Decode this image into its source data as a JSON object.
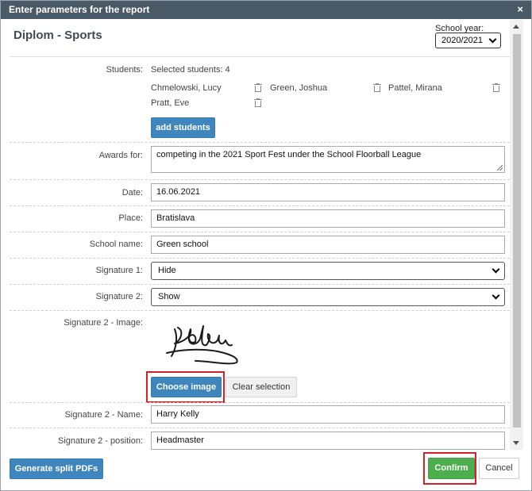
{
  "dialog": {
    "title": "Enter parameters for the report",
    "close_glyph": "×"
  },
  "header": {
    "page_title": "Diplom - Sports",
    "school_year_label": "School year:",
    "school_year_value": "2020/2021"
  },
  "students": {
    "label": "Students:",
    "selected_text": "Selected students: 4",
    "list": [
      {
        "name": "Chmelowski, Lucy"
      },
      {
        "name": "Green, Joshua"
      },
      {
        "name": "Pattel, Mirana"
      },
      {
        "name": "Pratt, Eve"
      }
    ],
    "add_button": "add students"
  },
  "fields": {
    "awards_label": "Awards for:",
    "awards_value": "competing in the 2021 Sport Fest under the School Floorball League",
    "date_label": "Date:",
    "date_value": "16.06.2021",
    "place_label": "Place:",
    "place_value": "Bratislava",
    "school_name_label": "School name:",
    "school_name_value": "Green school",
    "signature1_label": "Signature 1:",
    "signature1_value": "Hide",
    "signature2_label": "Signature 2:",
    "signature2_value": "Show",
    "signature2_image_label": "Signature 2 - Image:",
    "choose_image_button": "Choose image",
    "clear_selection_button": "Clear selection",
    "signature2_name_label": "Signature 2 - Name:",
    "signature2_name_value": "Harry Kelly",
    "signature2_position_label": "Signature 2 - position:",
    "signature2_position_value": "Headmaster"
  },
  "footer": {
    "generate_button": "Generate split PDFs",
    "confirm_button": "Confirm",
    "cancel_button": "Cancel"
  },
  "colors": {
    "titlebar": "#4a5966",
    "primary": "#3f86bf",
    "success": "#4cae4c",
    "highlight": "#d3232a"
  },
  "icons": {
    "delete": "trash-icon",
    "close": "close-icon",
    "dropdown": "chevron-down-icon"
  }
}
